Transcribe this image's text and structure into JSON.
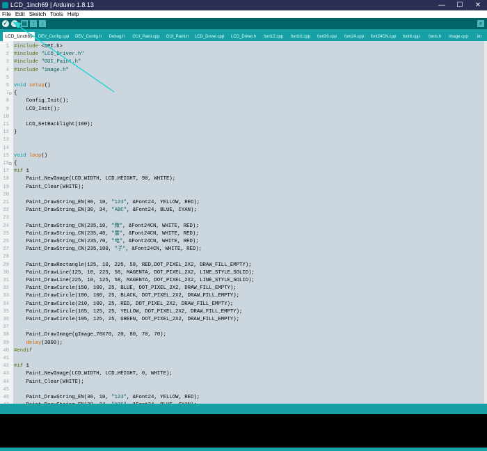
{
  "window": {
    "title": "LCD_1inch69 | Arduino 1.8.13",
    "min": "—",
    "max": "☐",
    "close": "✕"
  },
  "menu": [
    "File",
    "Edit",
    "Sketch",
    "Tools",
    "Help"
  ],
  "toolbar": {
    "verify_icon": "✓",
    "upload_icon": "→",
    "new_icon": "▤",
    "open_icon": "↑",
    "save_icon": "↓",
    "serial_icon": "⌕"
  },
  "tabs": [
    "LCD_1inch69",
    "DEV_Config.cpp",
    "DEV_Config.h",
    "Debug.h",
    "GUI_Paint.cpp",
    "GUI_Paint.h",
    "LCD_Driver.cpp",
    "LCD_Driver.h",
    "font12.cpp",
    "font16.cpp",
    "font20.cpp",
    "font24.cpp",
    "font24CN.cpp",
    "font8.cpp",
    "fonts.h",
    "image.cpp",
    "im"
  ],
  "lines": [
    {
      "n": "1",
      "t": "#include <SPI.h>"
    },
    {
      "n": "2",
      "t": "#include \"LCD_Driver.h\""
    },
    {
      "n": "3",
      "t": "#include \"GUI_Paint.h\""
    },
    {
      "n": "4",
      "t": "#include \"image.h\""
    },
    {
      "n": "5",
      "t": ""
    },
    {
      "n": "6",
      "t": "void setup()"
    },
    {
      "n": "7",
      "t": "{"
    },
    {
      "n": "8",
      "t": "    Config_Init();"
    },
    {
      "n": "9",
      "t": "    LCD_Init();"
    },
    {
      "n": "10",
      "t": ""
    },
    {
      "n": "11",
      "t": "    LCD_SetBacklight(100);"
    },
    {
      "n": "12",
      "t": "}"
    },
    {
      "n": "13",
      "t": ""
    },
    {
      "n": "14",
      "t": ""
    },
    {
      "n": "15",
      "t": "void loop()"
    },
    {
      "n": "16",
      "t": "{"
    },
    {
      "n": "17",
      "t": "#if 1"
    },
    {
      "n": "18",
      "t": "    Paint_NewImage(LCD_WIDTH, LCD_HEIGHT, 90, WHITE);"
    },
    {
      "n": "19",
      "t": "    Paint_Clear(WHITE);"
    },
    {
      "n": "20",
      "t": ""
    },
    {
      "n": "21",
      "t": "    Paint_DrawString_EN(30, 10, \"123\", &Font24, YELLOW, RED);"
    },
    {
      "n": "22",
      "t": "    Paint_DrawString_EN(30, 34, \"ABC\", &Font24, BLUE, CYAN);"
    },
    {
      "n": "23",
      "t": ""
    },
    {
      "n": "24",
      "t": "    Paint_DrawString_CN(235,10, \"微\", &Font24CN, WHITE, RED);"
    },
    {
      "n": "25",
      "t": "    Paint_DrawString_CN(235,40, \"雪\", &Font24CN, WHITE, RED);"
    },
    {
      "n": "26",
      "t": "    Paint_DrawString_CN(235,70, \"电\", &Font24CN, WHITE, RED);"
    },
    {
      "n": "27",
      "t": "    Paint_DrawString_CN(235,100, \"子\", &Font24CN, WHITE, RED);"
    },
    {
      "n": "28",
      "t": ""
    },
    {
      "n": "29",
      "t": "    Paint_DrawRectangle(125, 10, 225, 58, RED,DOT_PIXEL_2X2, DRAW_FILL_EMPTY);"
    },
    {
      "n": "30",
      "t": "    Paint_DrawLine(125, 10, 225, 58, MAGENTA, DOT_PIXEL_2X2, LINE_STYLE_SOLID);"
    },
    {
      "n": "31",
      "t": "    Paint_DrawLine(225, 10, 125, 58, MAGENTA, DOT_PIXEL_2X2, LINE_STYLE_SOLID);"
    },
    {
      "n": "32",
      "t": "    Paint_DrawCircle(150, 100, 25, BLUE, DOT_PIXEL_2X2, DRAW_FILL_EMPTY);"
    },
    {
      "n": "33",
      "t": "    Paint_DrawCircle(180, 100, 25, BLACK, DOT_PIXEL_2X2, DRAW_FILL_EMPTY);"
    },
    {
      "n": "34",
      "t": "    Paint_DrawCircle(210, 100, 25, RED, DOT_PIXEL_2X2, DRAW_FILL_EMPTY);"
    },
    {
      "n": "35",
      "t": "    Paint_DrawCircle(165, 125, 25, YELLOW, DOT_PIXEL_2X2, DRAW_FILL_EMPTY);"
    },
    {
      "n": "36",
      "t": "    Paint_DrawCircle(195, 125, 25, GREEN, DOT_PIXEL_2X2, DRAW_FILL_EMPTY);"
    },
    {
      "n": "37",
      "t": ""
    },
    {
      "n": "38",
      "t": "    Paint_DrawImage(gImage_70X70, 20, 80, 70, 70);"
    },
    {
      "n": "39",
      "t": "    delay(3000);"
    },
    {
      "n": "40",
      "t": "#endif"
    },
    {
      "n": "41",
      "t": ""
    },
    {
      "n": "42",
      "t": "#if 1"
    },
    {
      "n": "43",
      "t": "    Paint_NewImage(LCD_WIDTH, LCD_HEIGHT, 0, WHITE);"
    },
    {
      "n": "44",
      "t": "    Paint_Clear(WHITE);"
    },
    {
      "n": "45",
      "t": ""
    },
    {
      "n": "46",
      "t": "    Paint_DrawString_EN(30, 10, \"123\", &Font24, YELLOW, RED);"
    },
    {
      "n": "47",
      "t": "    Paint_DrawString_EN(30, 34, \"ABC\", &Font24, BLUE, CYAN);"
    }
  ],
  "colors": {
    "title_bg": "#2b2f56",
    "teal": "#006468",
    "tab_bg": "#17a1a5",
    "code_bg": "#ccd6de",
    "keyword": "#cc6600",
    "type": "#00979c",
    "string": "#005c5f",
    "preproc": "#5e6d03",
    "arrow": "#2fd3d6"
  }
}
